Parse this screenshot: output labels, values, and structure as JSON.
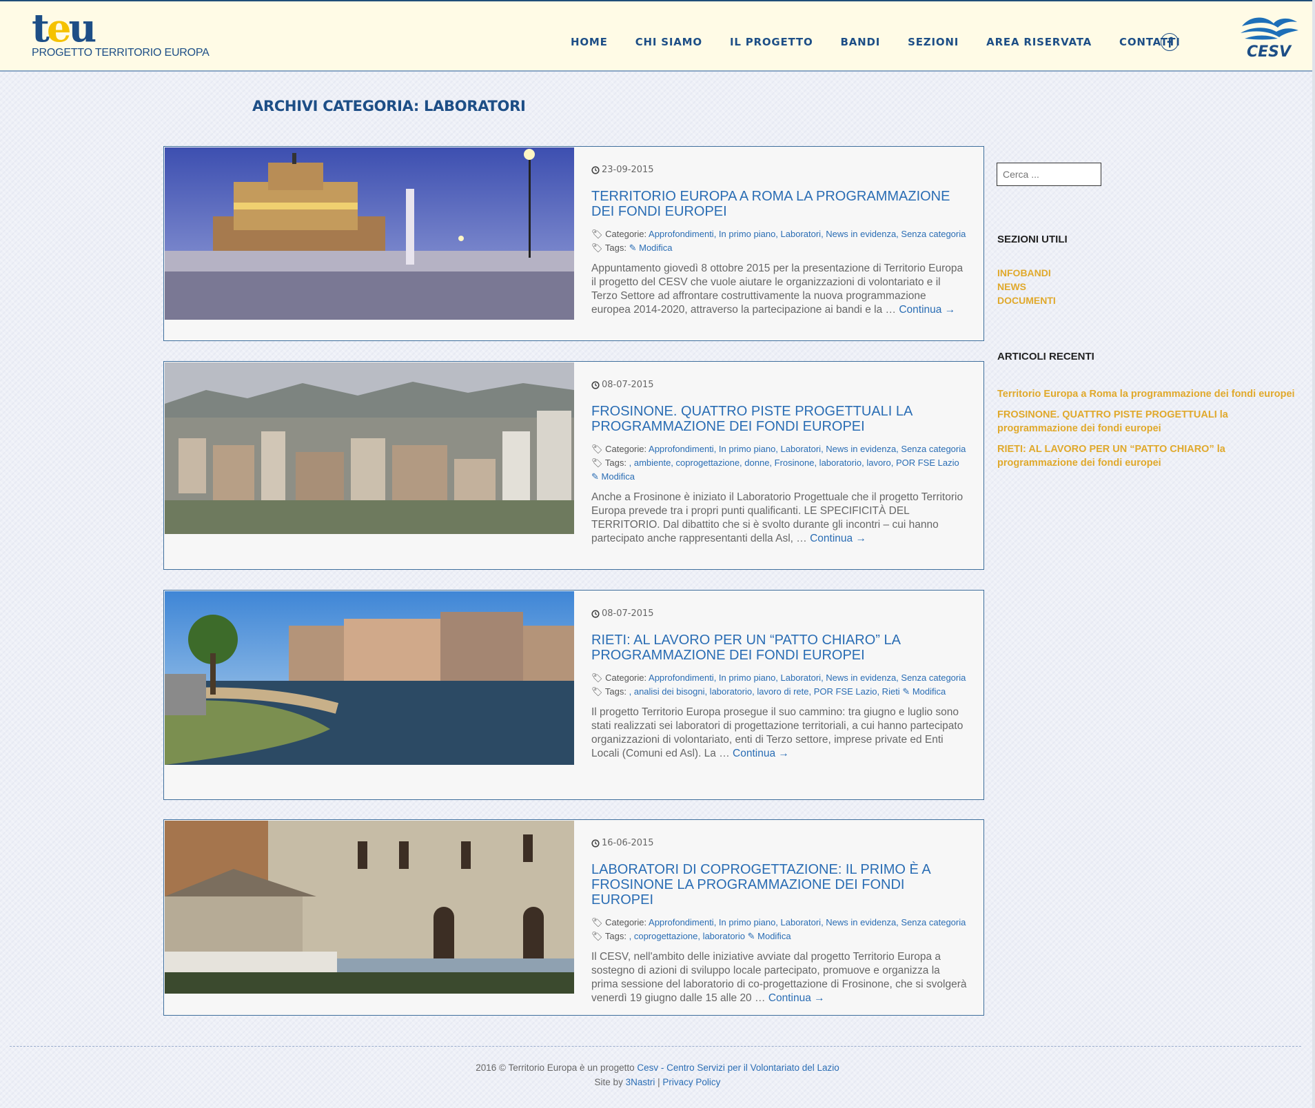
{
  "header": {
    "logo_word_a": "t",
    "logo_word_b": "e",
    "logo_word_c": "u",
    "logo_sub": "PROGETTO TERRITORIO EUROPA",
    "nav": [
      "HOME",
      "CHI SIAMO",
      "IL PROGETTO",
      "BANDI",
      "SEZIONI",
      "AREA RISERVATA",
      "CONTATTI"
    ],
    "facebook_icon": "facebook-icon",
    "partner_logo_text": "CESV"
  },
  "archive_title": "ARCHIVI CATEGORIA: LABORATORI",
  "labels": {
    "categories": "Categorie:",
    "tags": "Tags:",
    "edit": "Modifica",
    "more": "Continua →"
  },
  "posts": [
    {
      "date": "23-09-2015",
      "title": "TERRITORIO EUROPA A ROMA LA PROGRAMMAZIONE DEI FONDI EUROPEI",
      "categories": "Approfondimenti, In primo piano, Laboratori, News in evidenza, Senza categoria",
      "tags": "",
      "excerpt": "Appuntamento giovedì 8 ottobre 2015 per la presentazione di Territorio Europa il progetto del CESV che vuole aiutare le organizzazioni di volontariato e il Terzo Settore ad affrontare costruttivamente la nuova programmazione europea 2014-2020, attraverso la partecipazione ai bandi e la …"
    },
    {
      "date": "08-07-2015",
      "title": "FROSINONE. QUATTRO PISTE PROGETTUALI LA PROGRAMMAZIONE DEI FONDI EUROPEI",
      "categories": "Approfondimenti, In primo piano, Laboratori, News in evidenza, Senza categoria",
      "tags": ", ambiente, coprogettazione, donne, Frosinone, laboratorio, lavoro, POR FSE Lazio",
      "excerpt": "Anche a Frosinone è iniziato il Laboratorio Progettuale che il progetto Territorio Europa prevede tra i propri punti qualificanti. LE SPECIFICITÀ DEL TERRITORIO. Dal dibattito che si è svolto durante gli incontri – cui hanno partecipato anche rappresentanti della Asl, …"
    },
    {
      "date": "08-07-2015",
      "title": "RIETI: AL LAVORO PER UN “PATTO CHIARO” LA PROGRAMMAZIONE DEI FONDI EUROPEI",
      "categories": "Approfondimenti, In primo piano, Laboratori, News in evidenza, Senza categoria",
      "tags": ", analisi dei bisogni, laboratorio, lavoro di rete, POR FSE Lazio, Rieti",
      "excerpt": "Il progetto Territorio Europa prosegue il suo cammino: tra giugno e luglio sono stati realizzati sei laboratori di progettazione territoriali, a cui hanno partecipato organizzazioni di volontariato, enti di Terzo settore, imprese private ed Enti Locali (Comuni ed Asl). La …"
    },
    {
      "date": "16-06-2015",
      "title": "LABORATORI DI COPROGETTAZIONE: IL PRIMO È A FROSINONE LA PROGRAMMAZIONE DEI FONDI EUROPEI",
      "categories": "Approfondimenti, In primo piano, Laboratori, News in evidenza, Senza categoria",
      "tags": ", coprogettazione, laboratorio",
      "excerpt": "Il CESV, nell'ambito delle iniziative avviate dal progetto Territorio Europa a sostegno di azioni di sviluppo locale partecipato, promuove e organizza la prima sessione del laboratorio di co-progettazione di Frosinone, che si svolgerà venerdì 19 giugno dalle 15 alle 20 …"
    }
  ],
  "sidebar": {
    "search_placeholder": "Cerca ...",
    "useful_title": "SEZIONI UTILI",
    "useful_links": [
      "INFOBANDI",
      "NEWS",
      "DOCUMENTI"
    ],
    "recent_title": "ARTICOLI RECENTI",
    "recent_links": [
      "Territorio Europa a Roma la programmazione dei fondi europei",
      "FROSINONE. QUATTRO PISTE PROGETTUALI la programmazione dei fondi europei",
      "RIETI: AL LAVORO PER UN “PATTO CHIARO” la programmazione dei fondi europei"
    ]
  },
  "footer": {
    "line1_a": "2016 © Territorio Europa è un progetto",
    "line1_link": "Cesv - Centro Servizi per il Volontariato del Lazio",
    "line2_a": "Site by",
    "line2_link1": "3Nastri",
    "sep": "|",
    "line2_link2": "Privacy Policy"
  },
  "colors": {
    "brand_blue": "#1d4e86",
    "link_blue": "#2a6db4",
    "sidebar_gold": "#e0a92c",
    "header_bg": "#fffbe6"
  }
}
